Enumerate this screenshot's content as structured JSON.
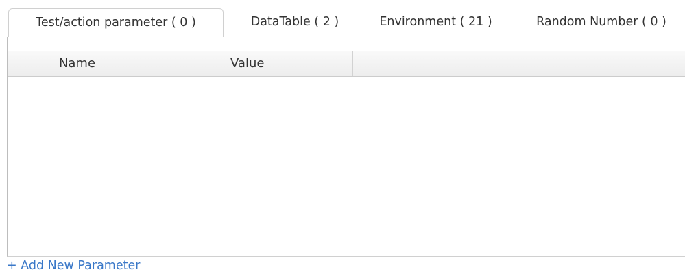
{
  "tabs": [
    {
      "label": "Test/action parameter ( 0 )",
      "active": true
    },
    {
      "label": "DataTable ( 2 )",
      "active": false
    },
    {
      "label": "Environment ( 21 )",
      "active": false
    },
    {
      "label": "Random Number ( 0 )",
      "active": false
    }
  ],
  "grid": {
    "columns": [
      "Name",
      "Value"
    ],
    "rows": []
  },
  "actions": {
    "add_parameter_label": "+ Add New Parameter"
  },
  "colors": {
    "link": "#3a78c8",
    "header_bg": "#f0f0f0",
    "border": "#d0d0d0"
  }
}
